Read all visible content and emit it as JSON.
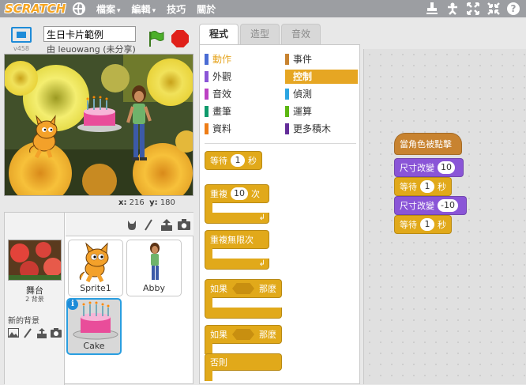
{
  "menubar": {
    "logo": "SCRATCH",
    "items": [
      {
        "label": "檔案",
        "caret": "▾"
      },
      {
        "label": "編輯",
        "caret": "▾"
      },
      {
        "label": "技巧",
        "caret": ""
      },
      {
        "label": "關於",
        "caret": ""
      }
    ]
  },
  "stage_header": {
    "version": "v458",
    "project_title": "生日卡片範例",
    "author": "由 leuowang (未分享)"
  },
  "coords": {
    "x_label": "x:",
    "x": "216",
    "y_label": "y:",
    "y": "180"
  },
  "sprite_pane": {
    "stage_label": "舞台",
    "stage_count": "2 背景",
    "new_backdrop_label": "新的背景",
    "sprites": [
      {
        "name": "Sprite1"
      },
      {
        "name": "Abby"
      },
      {
        "name": "Cake"
      }
    ],
    "info_glyph": "i"
  },
  "tabs": [
    {
      "label": "程式"
    },
    {
      "label": "造型"
    },
    {
      "label": "音效"
    }
  ],
  "categories": [
    {
      "label": "動作",
      "color": "#4a6cd4"
    },
    {
      "label": "事件",
      "color": "#c88330"
    },
    {
      "label": "外觀",
      "color": "#8a55d7"
    },
    {
      "label": "控制",
      "color": "#e1a91a"
    },
    {
      "label": "音效",
      "color": "#bb42c3"
    },
    {
      "label": "偵測",
      "color": "#2ca5e2"
    },
    {
      "label": "畫筆",
      "color": "#0e9a6c"
    },
    {
      "label": "運算",
      "color": "#5cb712"
    },
    {
      "label": "資料",
      "color": "#ee7d16"
    },
    {
      "label": "更多積木",
      "color": "#632d99"
    }
  ],
  "palette_blocks": {
    "wait": {
      "before": "等待",
      "value": "1",
      "after": "秒"
    },
    "repeat": {
      "before": "重複",
      "value": "10",
      "after": "次"
    },
    "forever": {
      "label": "重複無限次"
    },
    "if_then": {
      "before": "如果",
      "after": "那麼"
    },
    "if_else": {
      "before": "如果",
      "after": "那麼",
      "else": "否則"
    }
  },
  "script": {
    "hat": "當角色被點擊",
    "b1": {
      "before": "尺寸改變",
      "value": "10"
    },
    "b2": {
      "before": "等待",
      "value": "1",
      "after": "秒"
    },
    "b3": {
      "before": "尺寸改變",
      "value": "-10"
    },
    "b4": {
      "before": "等待",
      "value": "1",
      "after": "秒"
    }
  }
}
